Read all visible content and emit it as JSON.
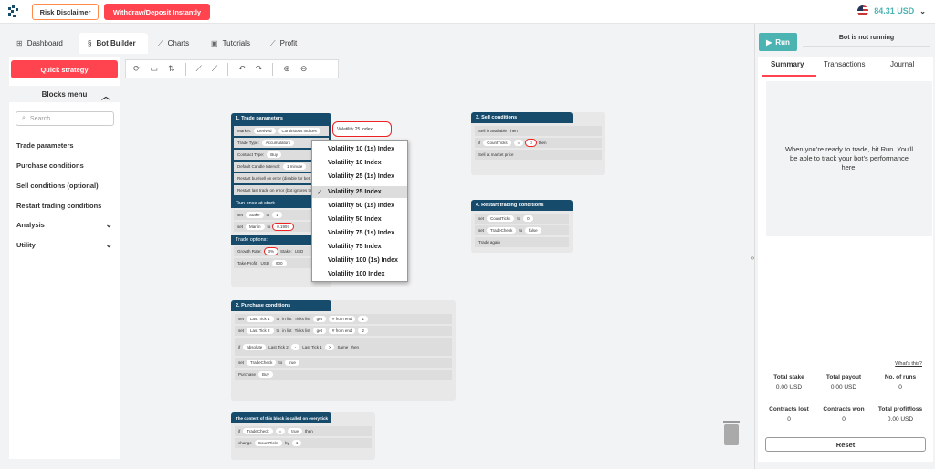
{
  "header": {
    "risk_disclaimer": "Risk Disclaimer",
    "withdraw": "Withdraw/Deposit Instantly",
    "balance": "84.31 USD"
  },
  "tabs": [
    {
      "label": "Dashboard",
      "icon": "dashboard-icon"
    },
    {
      "label": "Bot Builder",
      "icon": "bot-icon"
    },
    {
      "label": "Charts",
      "icon": "chart-icon"
    },
    {
      "label": "Tutorials",
      "icon": "tutorial-icon"
    },
    {
      "label": "Profit",
      "icon": "profit-icon"
    }
  ],
  "sidebar": {
    "quick_strategy": "Quick strategy",
    "blocks_menu": "Blocks menu",
    "search_placeholder": "Search",
    "items": [
      "Trade parameters",
      "Purchase conditions",
      "Sell conditions (optional)",
      "Restart trading conditions",
      "Analysis",
      "Utility"
    ]
  },
  "blocks": {
    "trade_params": {
      "title": "1. Trade parameters",
      "market": "Market:",
      "derived": "Derived",
      "continuous": "Continuous Indices",
      "vol": "Volatility 25 Index",
      "trade_type": "Trade Type:",
      "accumulators": "Accumulators",
      "contract_type": "Contract Type:",
      "buy": "Buy",
      "default_candle": "Default Candle Interval:",
      "minute": "1 minute",
      "restart_buy": "Restart buy/sell on error (disable for bett",
      "restart_last": "Restart last trade on error (bot ignores th",
      "run_once": "Run once at start:",
      "set": "set",
      "stake": "Stake",
      "to": "to",
      "one": "1",
      "martin": "Martin",
      "martin_val": "0.1997",
      "trade_options": "Trade options:",
      "growth": "Growth Rate:",
      "growth_val": "3%",
      "stake_lbl": "Stake:",
      "usd": "USD",
      "take_profit": "Take Profit:",
      "tp_val": "900"
    },
    "purchase": {
      "title": "2. Purchase conditions",
      "last1": "Last Tick 1",
      "last2": "Last Tick 2",
      "in_list": "in list",
      "ticks_list": "Ticks list",
      "get": "get",
      "from_end": "# from end",
      "one": "1",
      "two": "2",
      "if": "if",
      "absolute": "absolute",
      "minus": "-",
      "gt": ">",
      "same": "Same",
      "then": "then",
      "tradecheck": "TradeCheck",
      "true": "true",
      "purchase": "Purchase",
      "buy": "Buy"
    },
    "sell": {
      "title": "3. Sell conditions",
      "sell_avail": "Sell is available",
      "then": "then",
      "counts": "CountTicks",
      "eq": "=",
      "three": "3",
      "sell_market": "Sell at market price"
    },
    "restart": {
      "title": "4. Restart trading conditions",
      "set": "set",
      "counts": "CountTicks",
      "zero": "0",
      "tradecheck": "TradeCheck",
      "false": "false",
      "trade_again": "Trade again"
    },
    "every_tick": {
      "title": "The content of this block is called on every tick",
      "if": "if",
      "tradecheck": "TradeCheck",
      "eq": "=",
      "true": "true",
      "then": "then",
      "change": "change",
      "counts": "CountTicks",
      "by": "by",
      "one": "1"
    }
  },
  "dropdown": [
    "Volatility 10 (1s) Index",
    "Volatility 10 Index",
    "Volatility 25 (1s) Index",
    "Volatility 25 Index",
    "Volatility 50 (1s) Index",
    "Volatility 50 Index",
    "Volatility 75 (1s) Index",
    "Volatility 75 Index",
    "Volatility 100 (1s) Index",
    "Volatility 100 Index"
  ],
  "dropdown_selected": "Volatility 25 Index",
  "run_panel": {
    "run": "Run",
    "status": "Bot is not running",
    "tabs": [
      "Summary",
      "Transactions",
      "Journal"
    ],
    "empty_text": "When you’re ready to trade, hit Run. You’ll be able to track your bot’s performance here.",
    "whats_this": "What's this?",
    "stats": [
      {
        "label": "Total stake",
        "value": "0.00 USD"
      },
      {
        "label": "Total payout",
        "value": "0.00 USD"
      },
      {
        "label": "No. of runs",
        "value": "0"
      },
      {
        "label": "Contracts lost",
        "value": "0"
      },
      {
        "label": "Contracts won",
        "value": "0"
      },
      {
        "label": "Total profit/loss",
        "value": "0.00 USD"
      }
    ],
    "reset": "Reset"
  }
}
